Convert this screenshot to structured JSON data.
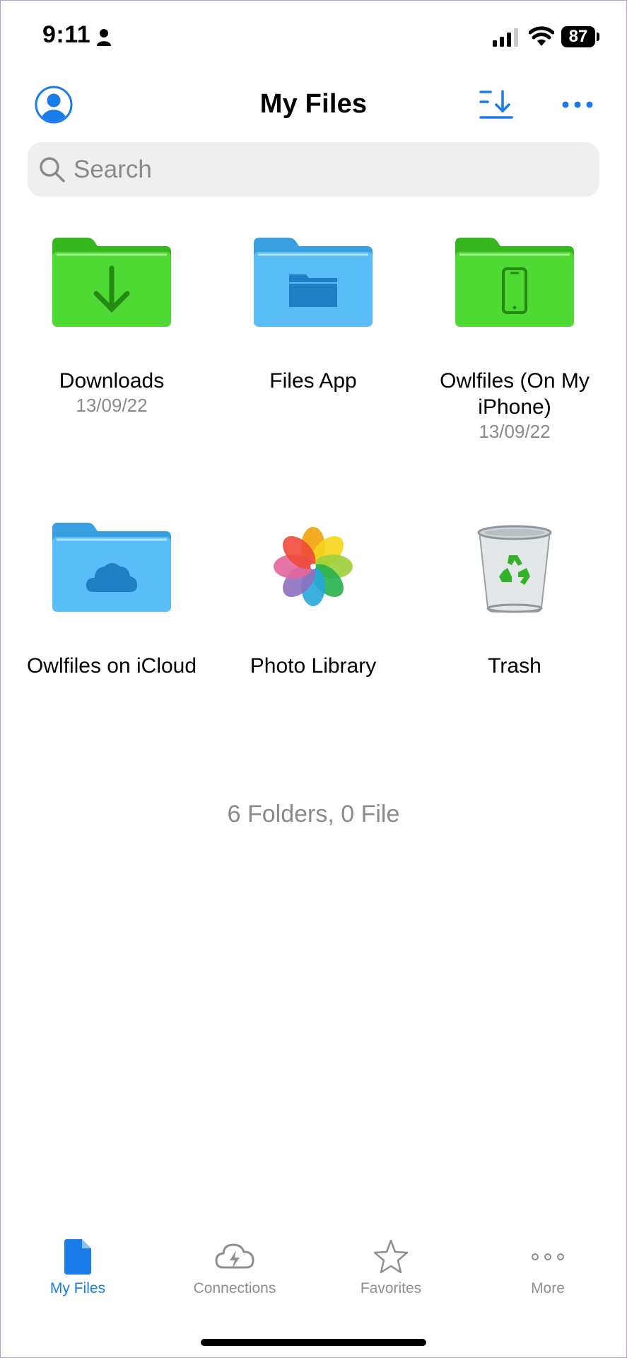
{
  "status_bar": {
    "time": "9:11",
    "battery": "87"
  },
  "nav": {
    "title": "My Files"
  },
  "search": {
    "placeholder": "Search",
    "value": ""
  },
  "items": [
    {
      "name": "Downloads",
      "date": "13/09/22",
      "icon": "green-folder-download-icon"
    },
    {
      "name": "Files App",
      "date": "",
      "icon": "blue-folder-icon"
    },
    {
      "name": "Owlfiles (On My iPhone)",
      "date": "13/09/22",
      "icon": "green-folder-phone-icon"
    },
    {
      "name": "Owlfiles on iCloud",
      "date": "",
      "icon": "blue-folder-cloud-icon"
    },
    {
      "name": "Photo Library",
      "date": "",
      "icon": "photos-icon"
    },
    {
      "name": "Trash",
      "date": "",
      "icon": "trash-bin-icon"
    }
  ],
  "summary": "6 Folders, 0 File",
  "tabs": [
    {
      "label": "My Files",
      "icon": "document-icon",
      "active": true
    },
    {
      "label": "Connections",
      "icon": "cloud-bolt-icon",
      "active": false
    },
    {
      "label": "Favorites",
      "icon": "star-icon",
      "active": false
    },
    {
      "label": "More",
      "icon": "more-dots-icon",
      "active": false
    }
  ],
  "colors": {
    "accent": "#1a7bea",
    "folder_green": "#3fcd2a",
    "folder_blue": "#4cb6f5",
    "secondary_text": "#8a8a8e"
  }
}
